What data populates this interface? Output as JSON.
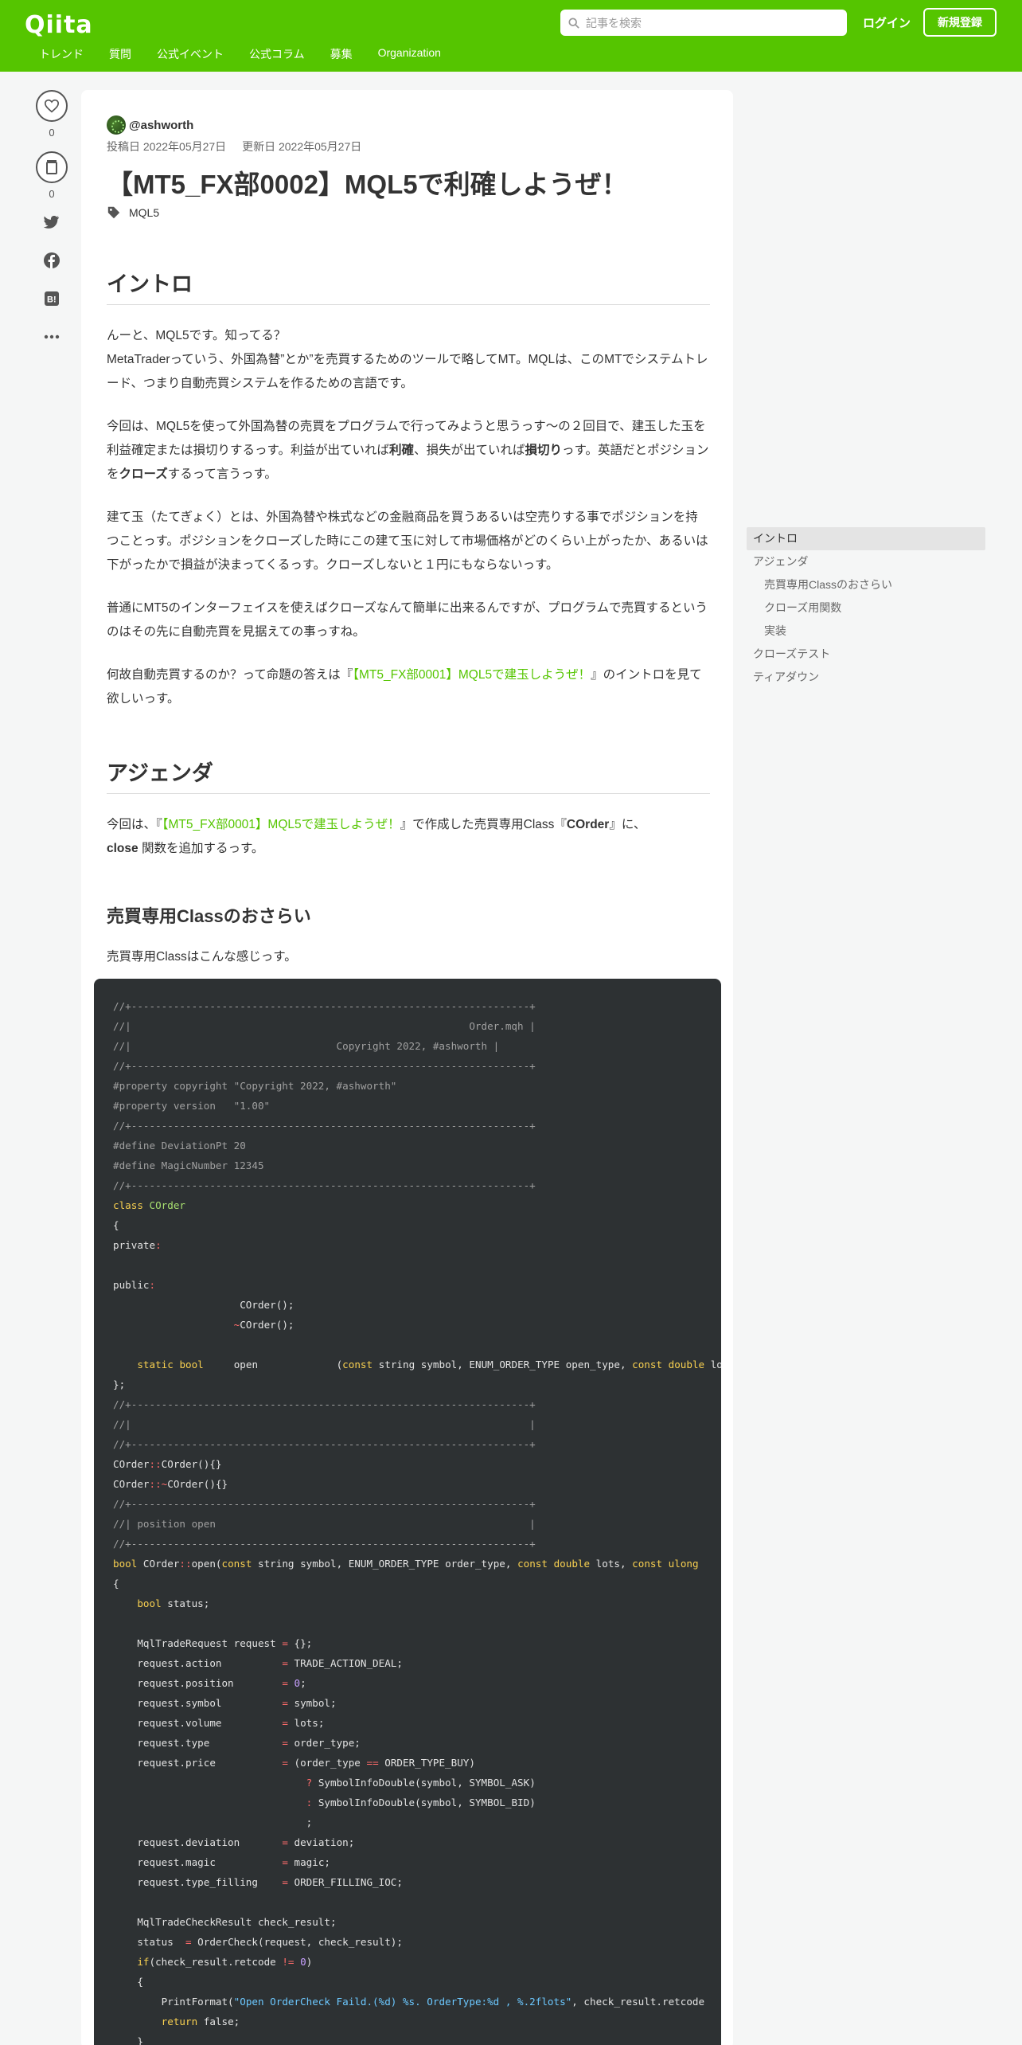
{
  "header": {
    "logo": "Qiita",
    "search_placeholder": "記事を検索",
    "login": "ログイン",
    "signup": "新規登録",
    "nav": [
      "トレンド",
      "質問",
      "公式イベント",
      "公式コラム",
      "募集",
      "Organization"
    ]
  },
  "side": {
    "like_count": "0",
    "stock_count": "0"
  },
  "article": {
    "author": "@ashworth",
    "posted": "投稿日 2022年05月27日",
    "updated": "更新日 2022年05月27日",
    "title": "【MT5_FX部0002】MQL5で利確しようぜ！",
    "tag": "MQL5"
  },
  "content": {
    "h_intro": "イントロ",
    "intro_p1_a": "んーと、MQL5です。知ってる？",
    "intro_p1_b": "MetaTraderっていう、外国為替”とか”を売買するためのツールで略してMT。MQLは、このMTでシステムトレード、つまり自動売買システムを作るための言語です。",
    "intro_p2_a": "今回は、MQL5を使って外国為替の売買をプログラムで行ってみようと思うっす～の２回目で、建玉した玉を利益確定または損切りするっす。利益が出ていれば",
    "intro_p2_b1": "利確",
    "intro_p2_c": "、損失が出ていれば",
    "intro_p2_b2": "損切り",
    "intro_p2_d": "っす。英語だとポジションを",
    "intro_p2_b3": "クローズ",
    "intro_p2_e": "するって言うっす。",
    "intro_p3": "建て玉（たてぎょく）とは、外国為替や株式などの金融商品を買うあるいは空売りする事でポジションを持つことっす。ポジションをクローズした時にこの建て玉に対して市場価格がどのくらい上がったか、あるいは下がったかで損益が決まってくるっす。クローズしないと１円にもならないっす。",
    "intro_p4": "普通にMT5のインターフェイスを使えばクローズなんて簡単に出来るんですが、プログラムで売買するというのはその先に自動売買を見据えての事っすね。",
    "intro_p5_a": "何故自動売買するのか？って命題の答えは『",
    "intro_p5_link": "【MT5_FX部0001】MQL5で建玉しようぜ！",
    "intro_p5_b": "』のイントロを見て欲しいっす。",
    "h_agenda": "アジェンダ",
    "agenda_a": "今回は、『",
    "agenda_link": "【MT5_FX部0001】MQL5で建玉しようぜ！",
    "agenda_b": "』で作成した売買専用Class『",
    "agenda_b1": "COrder",
    "agenda_c": "』に、",
    "agenda_b2": "close",
    "agenda_d": " 関数を追加するっす。",
    "h_review": "売買専用Classのおさらい",
    "review_p": "売買専用Classはこんな感じっす。"
  },
  "toc": [
    {
      "label": "イントロ",
      "level": 1,
      "active": true
    },
    {
      "label": "アジェンダ",
      "level": 1,
      "active": false
    },
    {
      "label": "売買専用Classのおさらい",
      "level": 2,
      "active": false
    },
    {
      "label": "クローズ用関数",
      "level": 2,
      "active": false
    },
    {
      "label": "実装",
      "level": 2,
      "active": false
    },
    {
      "label": "クローズテスト",
      "level": 1,
      "active": false
    },
    {
      "label": "ティアダウン",
      "level": 1,
      "active": false
    }
  ],
  "code_lines": [
    "//+------------------------------------------------------------------+",
    "//|                                                        Order.mqh |",
    "//|                                  Copyright 2022, #ashworth |",
    "//+------------------------------------------------------------------+",
    "#property copyright \"Copyright 2022, #ashworth\"",
    "#property version   \"1.00\"",
    "//+------------------------------------------------------------------+",
    "#define DeviationPt 20",
    "#define MagicNumber 12345",
    "//+------------------------------------------------------------------+",
    "class COrder",
    "{",
    "private:",
    "",
    "public:",
    "                     COrder();",
    "                    ~COrder();",
    "",
    "    static bool     open             (const string symbol, ENUM_ORDER_TYPE open_type, const double lots",
    "};",
    "//+------------------------------------------------------------------+",
    "//|                                                                  |",
    "//+------------------------------------------------------------------+",
    "COrder::COrder(){}",
    "COrder::~COrder(){}",
    "//+------------------------------------------------------------------+",
    "//| position open                                                    |",
    "//+------------------------------------------------------------------+",
    "bool COrder::open(const string symbol, ENUM_ORDER_TYPE order_type, const double lots, const ulong",
    "{",
    "    bool status;",
    "",
    "    MqlTradeRequest request = {};",
    "    request.action          = TRADE_ACTION_DEAL;",
    "    request.position        = 0;",
    "    request.symbol          = symbol;",
    "    request.volume          = lots;",
    "    request.type            = order_type;",
    "    request.price           = (order_type == ORDER_TYPE_BUY)",
    "                                ? SymbolInfoDouble(symbol, SYMBOL_ASK)",
    "                                : SymbolInfoDouble(symbol, SYMBOL_BID)",
    "                                ;",
    "    request.deviation       = deviation;",
    "    request.magic           = magic;",
    "    request.type_filling    = ORDER_FILLING_IOC;",
    "",
    "    MqlTradeCheckResult check_result;",
    "    status  = OrderCheck(request, check_result);",
    "    if(check_result.retcode != 0)",
    "    {",
    "        PrintFormat(\"Open OrderCheck Faild.(%d) %s. OrderType:%d , %.2flots\", check_result.retcode",
    "        return false;",
    "    }"
  ]
}
